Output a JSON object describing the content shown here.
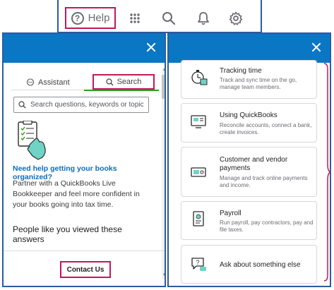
{
  "toolbar": {
    "help_label": "Help",
    "icons": [
      "apps-grid-icon",
      "search-icon",
      "bell-icon",
      "gear-icon"
    ]
  },
  "left_panel": {
    "tabs": [
      {
        "label": "Assistant",
        "icon": "chat-bubble-icon",
        "active": false
      },
      {
        "label": "Search",
        "icon": "search-icon",
        "active": true
      }
    ],
    "search": {
      "placeholder": "Search questions, keywords or topics",
      "value": ""
    },
    "promo": {
      "title": "Need help getting your books organized?",
      "text": "Partner with a QuickBooks Live Bookkeeper and feel more confident in your books going into tax time."
    },
    "people_heading": "People like you viewed these answers",
    "contact_label": "Contact Us"
  },
  "right_panel": {
    "cards": [
      {
        "title": "Tracking time",
        "desc": "Track and sync time on the go, manage team members.",
        "icon": "stopwatch-icon"
      },
      {
        "title": "Using QuickBooks",
        "desc": "Reconcile accounts, connect a bank, create invoices.",
        "icon": "computer-icon"
      },
      {
        "title": "Customer and vendor payments",
        "desc": "Manage and track online payments and income.",
        "icon": "money-icon"
      },
      {
        "title": "Payroll",
        "desc": "Run payroll, pay contractors, pay and file taxes.",
        "icon": "payroll-document-icon"
      },
      {
        "title": "Ask about something else",
        "desc": "",
        "icon": "chat-question-icon"
      }
    ]
  },
  "colors": {
    "header_blue": "#0a77c5",
    "highlight": "#c2185b",
    "frame": "#2d5ba0",
    "accent_green": "#2ca01c",
    "link_blue": "#0a6dbd"
  }
}
